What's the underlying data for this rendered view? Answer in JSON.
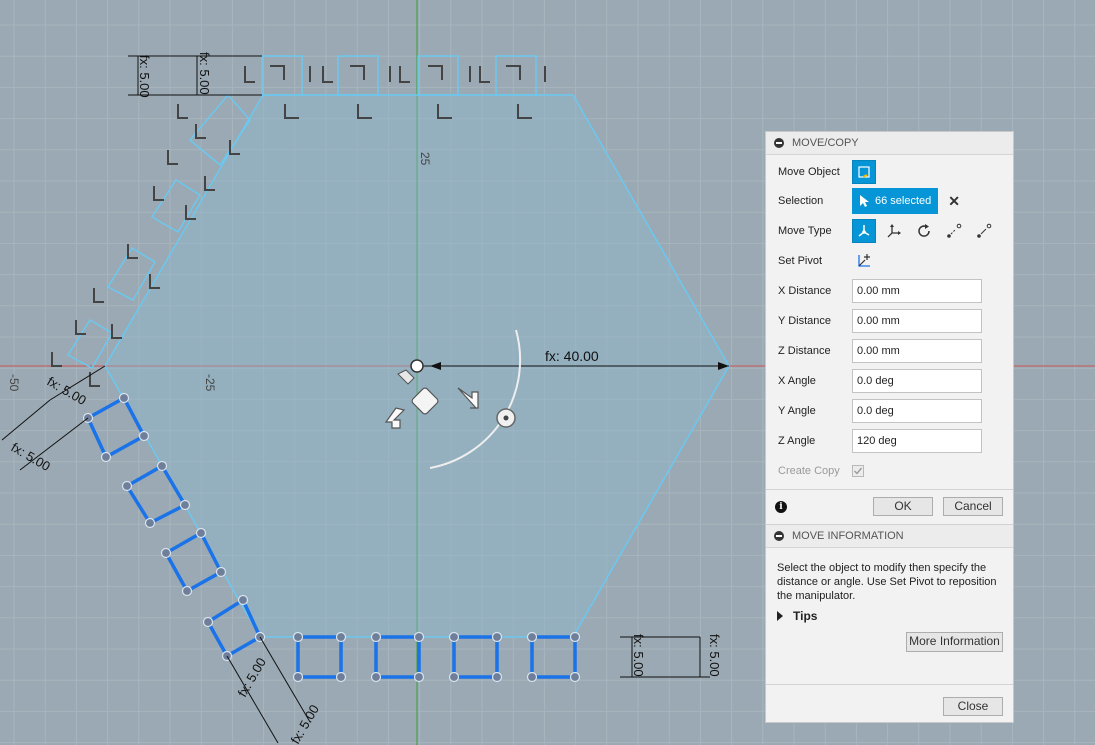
{
  "canvas": {
    "axis_labels": {
      "v25": "25",
      "hneg50": "-50",
      "hneg25": "-25"
    },
    "dimension": {
      "fx40": "fx: 40.00",
      "fx5": "fx: 5.00",
      "fx5_short": "fx: 5.00"
    },
    "colors": {
      "background": "#9aa9b3",
      "sketch_line": "#6bc8f0",
      "selected": "#1a73e8",
      "dim_line": "#111111",
      "axis_red": "#d04040",
      "axis_green": "#30a030"
    }
  },
  "panel": {
    "title": "MOVE/COPY",
    "move_object_label": "Move Object",
    "selection_label": "Selection",
    "selection_value": "66 selected",
    "move_type_label": "Move Type",
    "set_pivot_label": "Set Pivot",
    "fields": [
      {
        "label": "X Distance",
        "value": "0.00 mm"
      },
      {
        "label": "Y Distance",
        "value": "0.00 mm"
      },
      {
        "label": "Z Distance",
        "value": "0.00 mm"
      },
      {
        "label": "X Angle",
        "value": "0.0 deg"
      },
      {
        "label": "Y Angle",
        "value": "0.0 deg"
      },
      {
        "label": "Z Angle",
        "value": "120 deg"
      }
    ],
    "create_copy_label": "Create Copy",
    "ok_label": "OK",
    "cancel_label": "Cancel",
    "info_title": "MOVE INFORMATION",
    "info_text": "Select the object to modify then specify the distance or angle. Use Set Pivot to reposition the manipulator.",
    "tips_label": "Tips",
    "more_info_label": "More Information",
    "close_label": "Close",
    "accent": "#0696d7"
  }
}
